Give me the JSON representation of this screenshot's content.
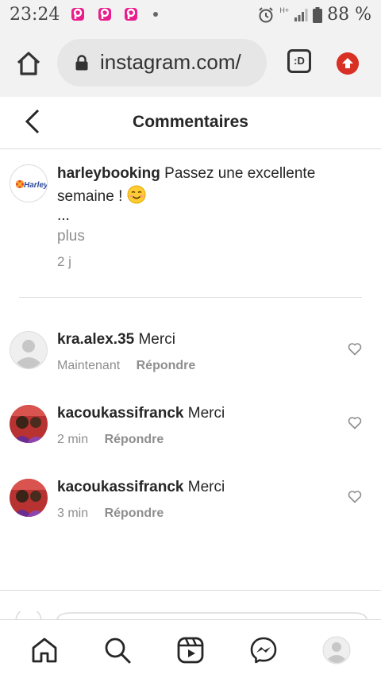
{
  "status_bar": {
    "time": "23:24",
    "network": "H+",
    "battery": "88 %",
    "icons": [
      "pinterest-icon",
      "pinterest-icon",
      "pinterest-icon",
      "alarm-icon",
      "signal-icon",
      "battery-icon"
    ]
  },
  "browser": {
    "url": "instagram.com/",
    "tab_label": ":D"
  },
  "header": {
    "title": "Commentaires"
  },
  "caption": {
    "username": "harleybooking",
    "text": "Passez une excellente semaine !",
    "ellipsis": "...",
    "more_label": "plus",
    "time": "2 j",
    "logo_text": "Harley"
  },
  "comments": [
    {
      "username": "kra.alex.35",
      "text": "Merci",
      "time": "Maintenant",
      "reply_label": "Répondre"
    },
    {
      "username": "kacoukassifranck",
      "text": "Merci",
      "time": "2 min",
      "reply_label": "Répondre"
    },
    {
      "username": "kacoukassifranck",
      "text": "Merci",
      "time": "3 min",
      "reply_label": "Répondre"
    }
  ],
  "colors": {
    "accent_red": "#d93025",
    "muted_text": "#8e8e8e",
    "pinterest_pink": "#e91e8c"
  }
}
